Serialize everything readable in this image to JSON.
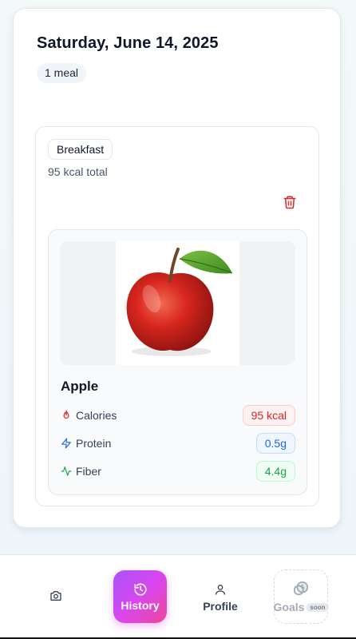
{
  "day": {
    "date_title": "Saturday, June 14, 2025",
    "meal_count": "1 meal"
  },
  "meal": {
    "type_label": "Breakfast",
    "total_label": "95 kcal total",
    "food": {
      "name": "Apple",
      "image_icon": "apple-photo",
      "nutrients": [
        {
          "label": "Calories",
          "value": "95 kcal",
          "icon": "flame-icon",
          "color": "#dc2626"
        },
        {
          "label": "Protein",
          "value": "0.5g",
          "icon": "bolt-icon",
          "color": "#2563eb"
        },
        {
          "label": "Fiber",
          "value": "4.4g",
          "icon": "activity-icon",
          "color": "#16a34a"
        }
      ]
    }
  },
  "nav": {
    "camera_icon": "camera-icon",
    "history_label": "History",
    "profile_label": "Profile",
    "goals_label": "Goals",
    "goals_badge": "soon",
    "active_gradient": [
      "#a855f7",
      "#ec4899"
    ]
  }
}
